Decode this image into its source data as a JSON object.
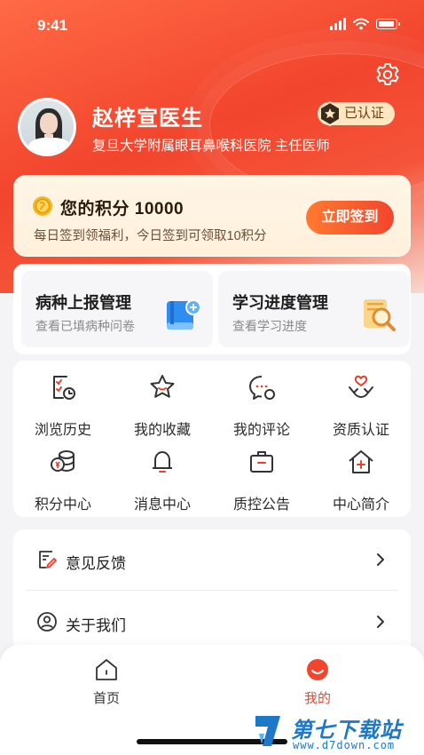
{
  "status_bar": {
    "time": "9:41"
  },
  "profile": {
    "name": "赵梓宣医生",
    "hospital_title": "复旦大学附属眼耳鼻喉科医院  主任医师",
    "verified_badge": "已认证"
  },
  "points": {
    "title": "您的积分  10000",
    "desc": "每日签到领福利，今日签到可领取10积分",
    "signin_button": "立即签到"
  },
  "management": [
    {
      "title": "病种上报管理",
      "subtitle": "查看已填病种问卷",
      "icon": "book-plus-icon"
    },
    {
      "title": "学习进度管理",
      "subtitle": "查看学习进度",
      "icon": "document-search-icon"
    }
  ],
  "grid": [
    {
      "label": "浏览历史",
      "icon": "history-icon"
    },
    {
      "label": "我的收藏",
      "icon": "star-icon"
    },
    {
      "label": "我的评论",
      "icon": "comment-icon"
    },
    {
      "label": "资质认证",
      "icon": "heart-hands-icon"
    },
    {
      "label": "积分中心",
      "icon": "coins-icon"
    },
    {
      "label": "消息中心",
      "icon": "bell-icon"
    },
    {
      "label": "质控公告",
      "icon": "briefcase-icon"
    },
    {
      "label": "中心简介",
      "icon": "home-plus-icon"
    }
  ],
  "list": [
    {
      "label": "意见反馈",
      "icon": "feedback-icon"
    },
    {
      "label": "关于我们",
      "icon": "about-icon"
    }
  ],
  "tabs": [
    {
      "label": "首页",
      "icon": "home-icon",
      "active": false
    },
    {
      "label": "我的",
      "icon": "profile-face-icon",
      "active": true
    }
  ],
  "colors": {
    "accent": "#f2452d",
    "accent_orange": "#ff7a30",
    "watermark_blue": "#1e78c8"
  },
  "watermark": {
    "title": "第七下载站",
    "url": "www.d7down.com"
  }
}
